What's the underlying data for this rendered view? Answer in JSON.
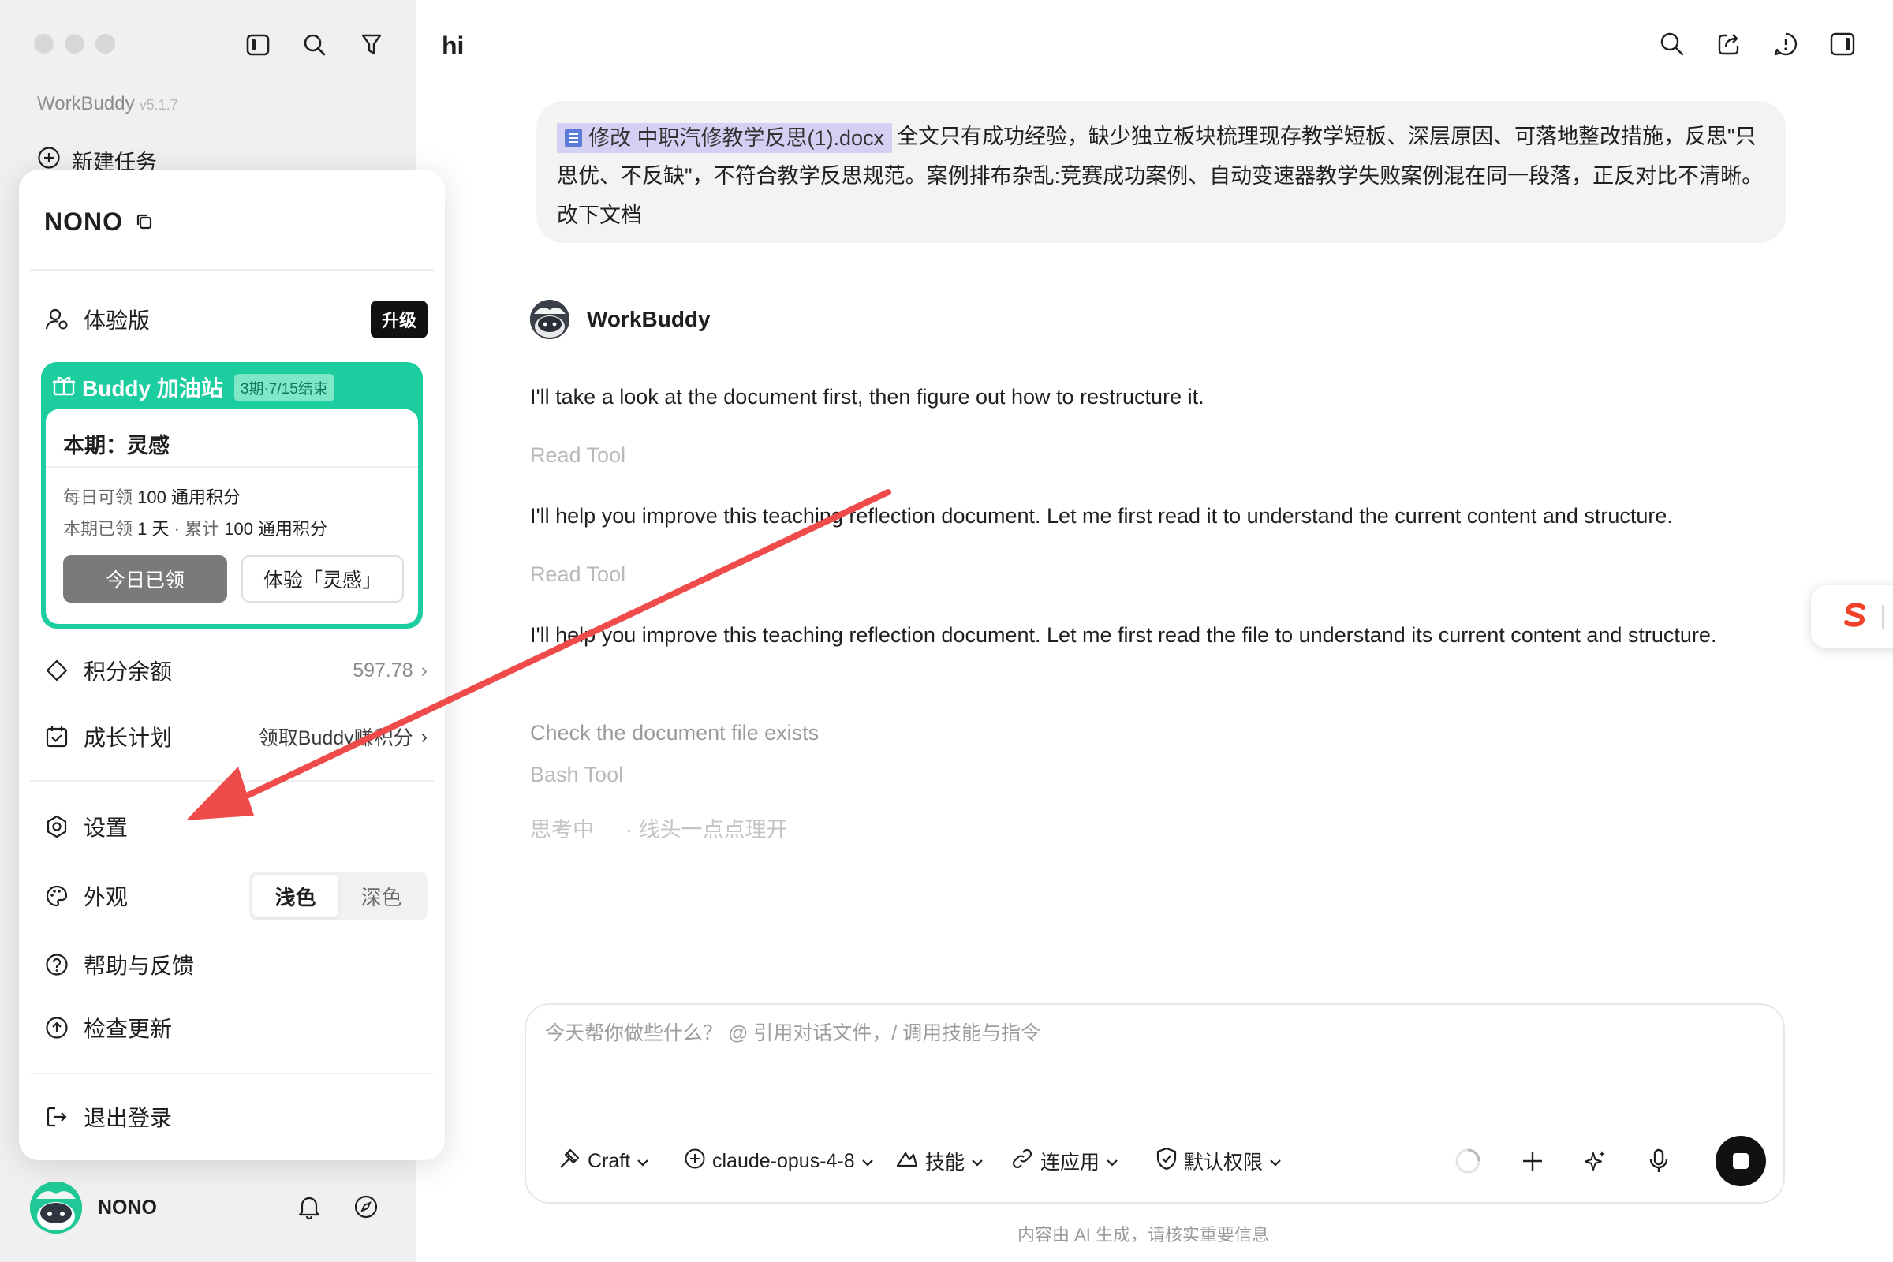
{
  "sidebar": {
    "app_name": "WorkBuddy",
    "app_version": "v5.1.7",
    "new_task_label": "新建任务",
    "username": "NONO"
  },
  "popup": {
    "user_name": "NONO",
    "plan_label": "体验版",
    "upgrade_label": "升级",
    "buddy": {
      "title": "Buddy 加油站",
      "badge": "3期·7/15结束",
      "period_label": "本期：灵感",
      "daily_prefix": "每日可领",
      "daily_value": "100 通用积分",
      "claimed_prefix": "本期已领",
      "claimed_days": "1 天",
      "sep": "·",
      "total_prefix": "累计",
      "total_value": "100 通用积分",
      "claimed_button": "今日已领",
      "try_button": "体验「灵感」"
    },
    "points_label": "积分余额",
    "points_value": "597.78",
    "growth_label": "成长计划",
    "growth_value": "领取Buddy赚积分",
    "settings_label": "设置",
    "appearance_label": "外观",
    "theme_light": "浅色",
    "theme_dark": "深色",
    "help_label": "帮助与反馈",
    "update_label": "检查更新",
    "logout_label": "退出登录"
  },
  "main": {
    "title": "hi",
    "user_message": {
      "file_chip": "修改 中职汽修教学反思(1).docx",
      "text": "全文只有成功经验，缺少独立板块梳理现存教学短板、深层原因、可落地整改措施，反思\"只思优、不反缺\"，不符合教学反思规范。案例排布杂乱:竞赛成功案例、自动变速器教学失败案例混在同一段落，正反对比不清晰。 改下文档"
    },
    "bot_name": "WorkBuddy",
    "messages": [
      "I'll take a look at the document first, then figure out how to restructure it.",
      "I'll help you improve this teaching reflection document. Let me first read it to understand the current content and structure.",
      "I'll help you improve this teaching reflection document. Let me first read the file to understand its current content and structure."
    ],
    "tool_read": "Read Tool",
    "step_check": "Check the document file exists",
    "tool_bash": "Bash Tool",
    "thinking_label": "思考中",
    "thinking_detail": "· 线头一点点理开"
  },
  "input": {
    "placeholder": "今天帮你做些什么？ @ 引用对话文件，/ 调用技能与指令",
    "value": "",
    "mode_label": "Craft",
    "model_label": "claude-opus-4-8",
    "skills_label": "技能",
    "apps_label": "连应用",
    "permission_label": "默认权限",
    "disclaimer": "内容由 AI 生成，请核实重要信息"
  },
  "colors": {
    "accent_green": "#1ccda0",
    "annotation_arrow": "#ef4b4b",
    "sidebar_bg": "#f0f0f1"
  }
}
